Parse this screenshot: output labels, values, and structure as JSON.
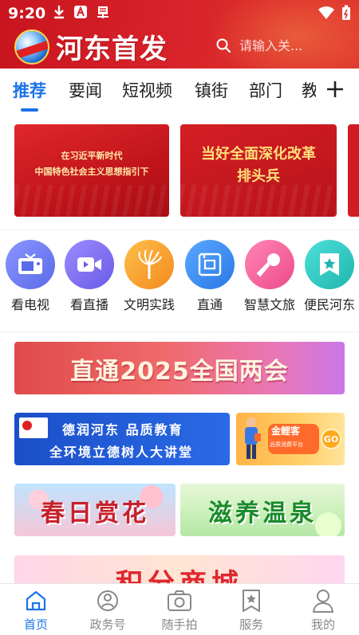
{
  "status_bar": {
    "time": "9:20"
  },
  "header": {
    "app_name": "河东首发",
    "search_placeholder": "请输入关..."
  },
  "tabs": [
    {
      "label": "推荐",
      "active": true
    },
    {
      "label": "要闻"
    },
    {
      "label": "短视频"
    },
    {
      "label": "镇街"
    },
    {
      "label": "部门"
    },
    {
      "label": "教"
    }
  ],
  "carousel": {
    "banners": [
      {
        "line1": "在习近平新时代",
        "line2": "中国特色社会主义思想指引下"
      },
      {
        "line1": "当好全面深化改革",
        "line2": "排头兵"
      }
    ]
  },
  "quick_entries": [
    {
      "label": "看电视",
      "icon": "tv-icon",
      "color": "#6c7cf4"
    },
    {
      "label": "看直播",
      "icon": "video-camera-icon",
      "color": "#7a6ef2"
    },
    {
      "label": "文明实践",
      "icon": "torch-icon",
      "color": "#f6a23a"
    },
    {
      "label": "直通",
      "icon": "ask-icon",
      "color": "#3a8df2"
    },
    {
      "label": "智慧文旅",
      "icon": "microphone-icon",
      "color": "#f0629a"
    },
    {
      "label": "便民河东",
      "icon": "star-bookmark-icon",
      "color": "#2ec8c0"
    }
  ],
  "features": {
    "two_sessions": "直通2025全国两会",
    "education": {
      "line1": "德润河东  品质教育",
      "line2": "全环境立德树人大讲堂"
    },
    "gold": {
      "title": "金鲤客",
      "subtitle": "品质消费平台",
      "go": "GO"
    },
    "flower": "春日赏花",
    "spring": "滋养温泉",
    "mall": "积分商城"
  },
  "bottom_nav": [
    {
      "label": "首页",
      "icon": "home-icon",
      "active": true
    },
    {
      "label": "政务号",
      "icon": "government-account-icon"
    },
    {
      "label": "随手拍",
      "icon": "camera-icon"
    },
    {
      "label": "服务",
      "icon": "service-bookmark-icon"
    },
    {
      "label": "我的",
      "icon": "profile-icon"
    }
  ],
  "colors": {
    "brand_red": "#d8232a",
    "accent_blue": "#1a73e8"
  }
}
